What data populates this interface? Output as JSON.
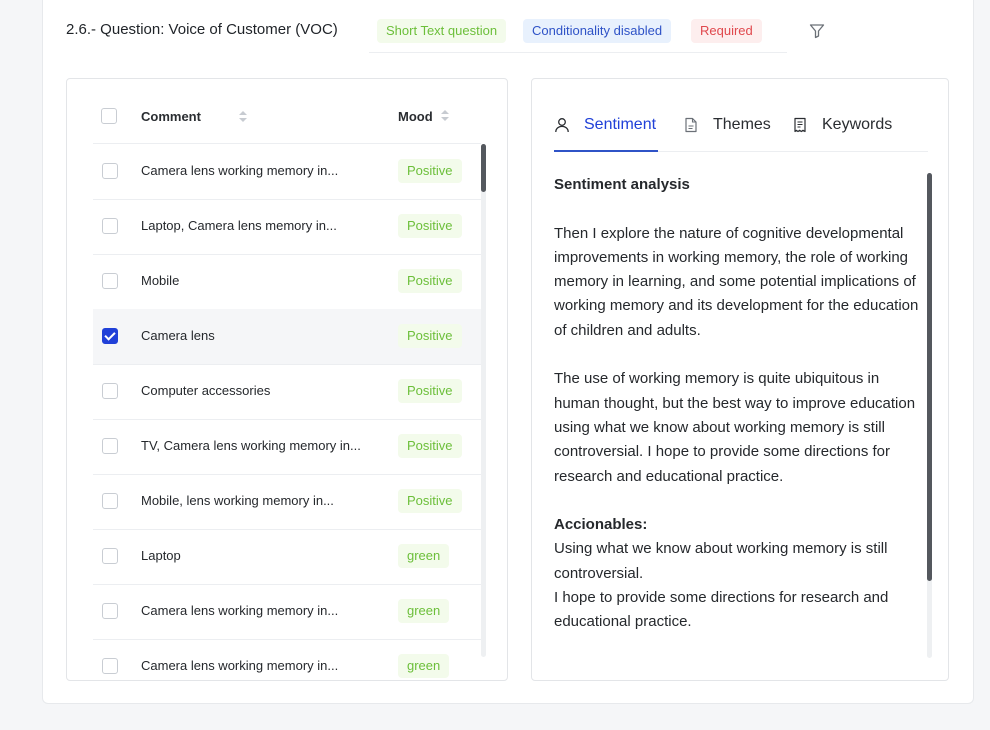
{
  "question": {
    "title": "2.6.- Question: Voice of Customer (VOC)",
    "tags": {
      "type": "Short Text question",
      "conditionality": "Conditionality disabled",
      "required": "Required"
    }
  },
  "table": {
    "columns": {
      "comment": "Comment",
      "mood": "Mood"
    },
    "rows": [
      {
        "comment": "Camera lens working memory in...",
        "mood": "Positive",
        "checked": false
      },
      {
        "comment": "Laptop, Camera lens memory in...",
        "mood": "Positive",
        "checked": false
      },
      {
        "comment": "Mobile",
        "mood": "Positive",
        "checked": false
      },
      {
        "comment": "Camera lens",
        "mood": "Positive",
        "checked": true
      },
      {
        "comment": "Computer accessories",
        "mood": "Positive",
        "checked": false
      },
      {
        "comment": "TV, Camera lens working memory in...",
        "mood": "Positive",
        "checked": false
      },
      {
        "comment": "Mobile, lens working memory in...",
        "mood": "Positive",
        "checked": false
      },
      {
        "comment": "Laptop",
        "mood": "green",
        "checked": false
      },
      {
        "comment": "Camera lens working memory in...",
        "mood": "green",
        "checked": false
      },
      {
        "comment": "Camera lens working memory in...",
        "mood": "green",
        "checked": false
      }
    ]
  },
  "analysis": {
    "tabs": [
      {
        "label": "Sentiment",
        "icon": "user-icon",
        "active": true
      },
      {
        "label": "Themes",
        "icon": "document-icon",
        "active": false
      },
      {
        "label": "Keywords",
        "icon": "receipt-icon",
        "active": false
      }
    ],
    "heading": "Sentiment analysis",
    "paragraph1": "Then I explore the nature of cognitive developmental improvements in working memory, the role of working memory in learning, and some potential implications of working memory and its development for the education of children and adults.",
    "paragraph2": "The use of working memory is quite ubiquitous in human thought, but the best way to improve education using what we know about working memory is still controversial. I hope to provide some directions for research and educational practice.",
    "actions_heading": "Accionables:",
    "action1": "Using what we know about working memory is still controversial.",
    "action2": "I hope to provide some directions for research and educational practice."
  },
  "colors": {
    "accent": "#2040d8",
    "positive_text": "#6cbf3a",
    "required_text": "#e0484d"
  }
}
